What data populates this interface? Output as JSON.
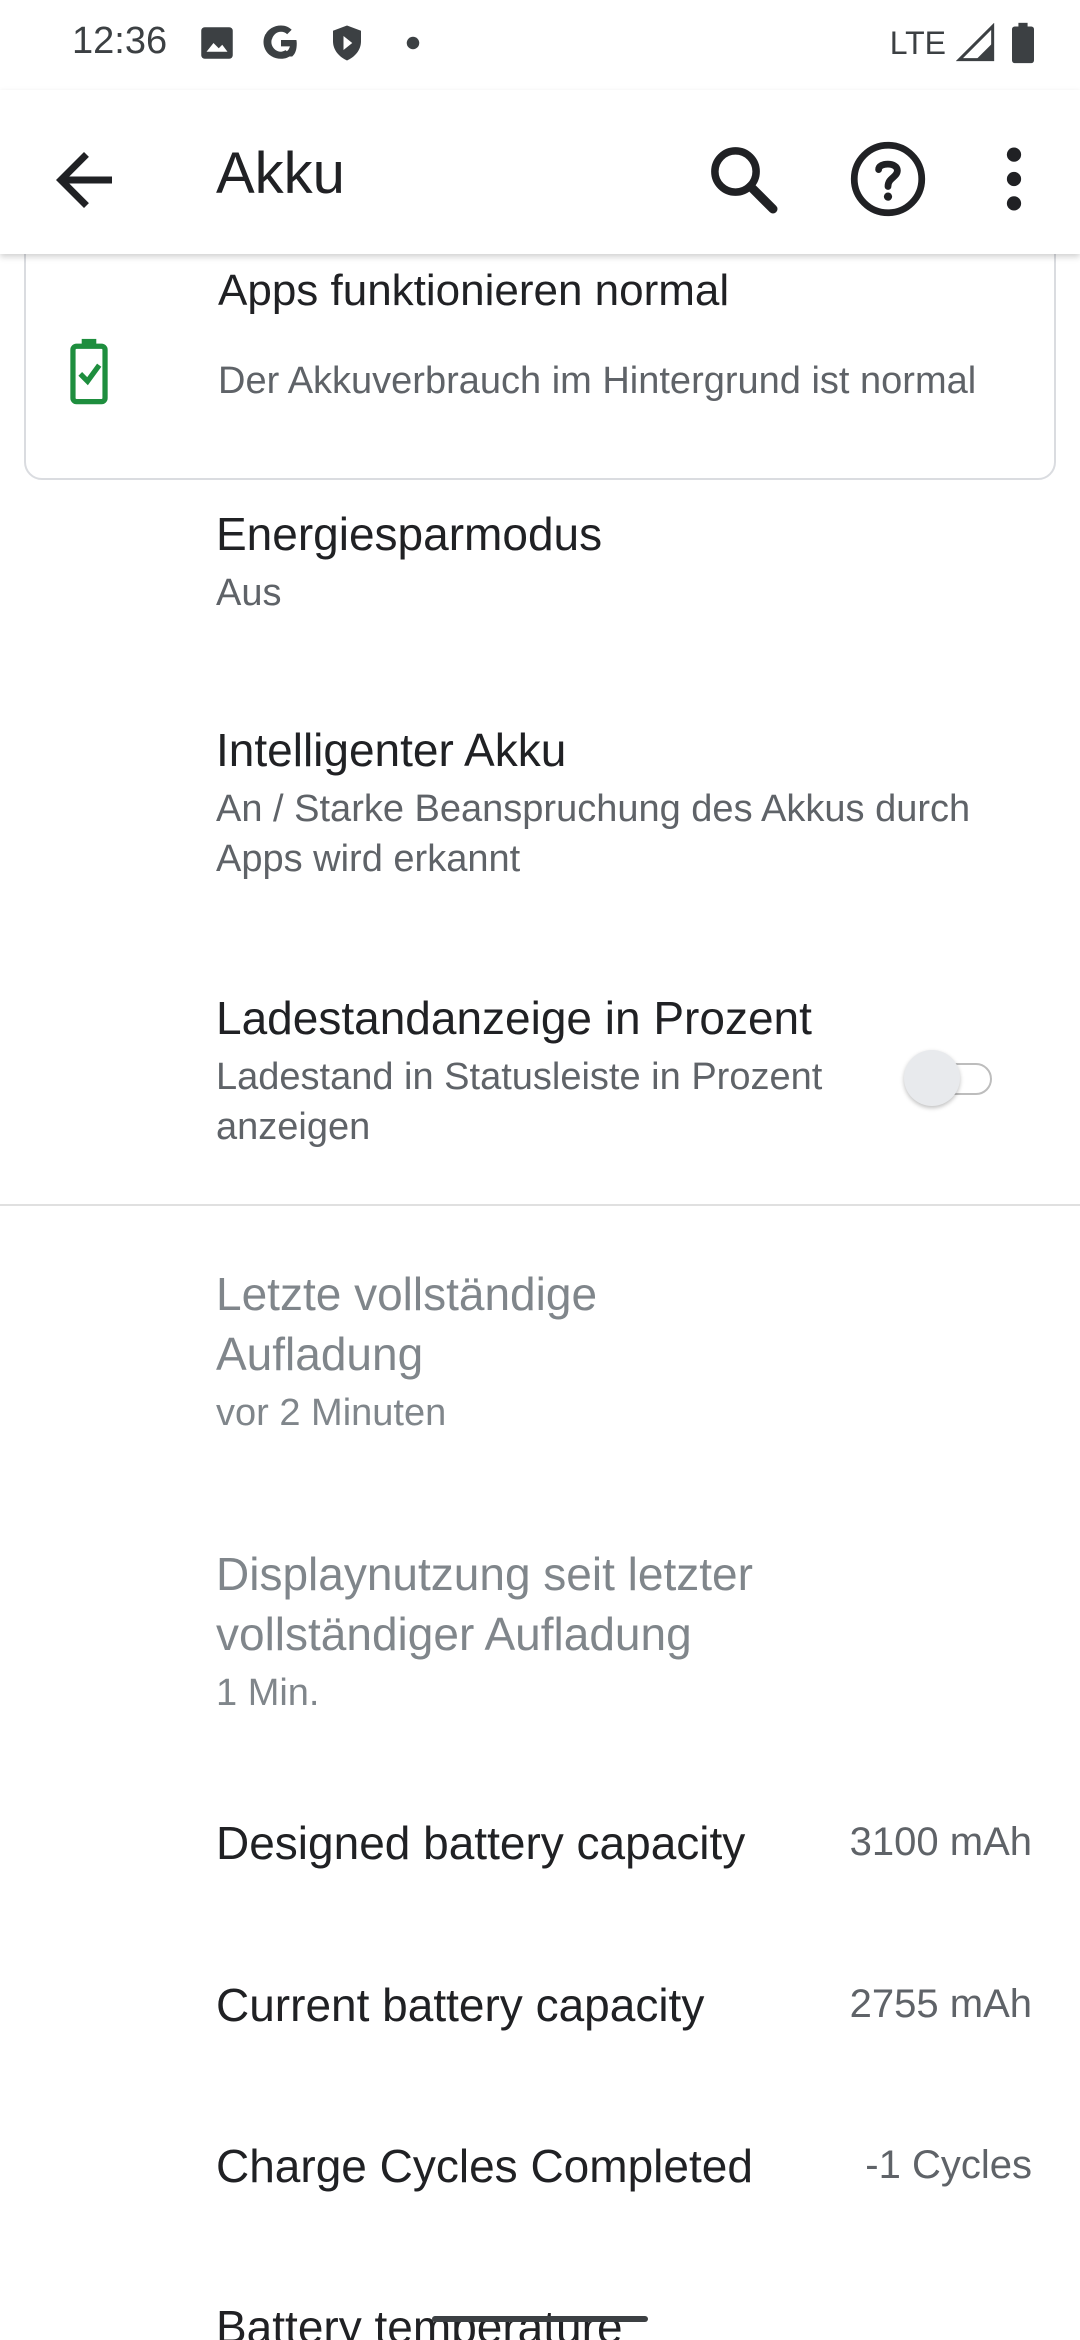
{
  "status_bar": {
    "time": "12:36",
    "network": "LTE",
    "icons": [
      "image-icon",
      "google-icon",
      "shield-icon",
      "dot-icon",
      "signal-icon",
      "battery-icon"
    ]
  },
  "app_bar": {
    "title": "Akku",
    "actions": [
      "search-icon",
      "help-icon",
      "more-vert-icon"
    ]
  },
  "battery_card": {
    "title": "Apps funktionieren normal",
    "subtitle": "Der Akkuverbrauch im Hintergrund ist normal",
    "icon_color": "#1e8e3e"
  },
  "settings": [
    {
      "title": "Energiesparmodus",
      "summary": "Aus"
    },
    {
      "title": "Intelligenter Akku",
      "summary": "An / Starke Beanspruchung des Akkus durch Apps wird erkannt"
    },
    {
      "title": "Ladestandanzeige in Prozent",
      "summary": "Ladestand in Statusleiste in Prozent anzeigen",
      "toggle_on": false
    }
  ],
  "info": [
    {
      "title": "Letzte vollständige Aufladung",
      "summary": "vor 2 Minuten"
    },
    {
      "title": "Displaynutzung seit letzter vollständiger Aufladung",
      "summary": "1 Min."
    }
  ],
  "stats": [
    {
      "label": "Designed battery capacity",
      "value": "3100 mAh"
    },
    {
      "label": "Current battery capacity",
      "value": "2755 mAh"
    },
    {
      "label": "Charge Cycles Completed",
      "value": "-1 Cycles"
    },
    {
      "label": "Battery temperature",
      "value": ""
    }
  ]
}
